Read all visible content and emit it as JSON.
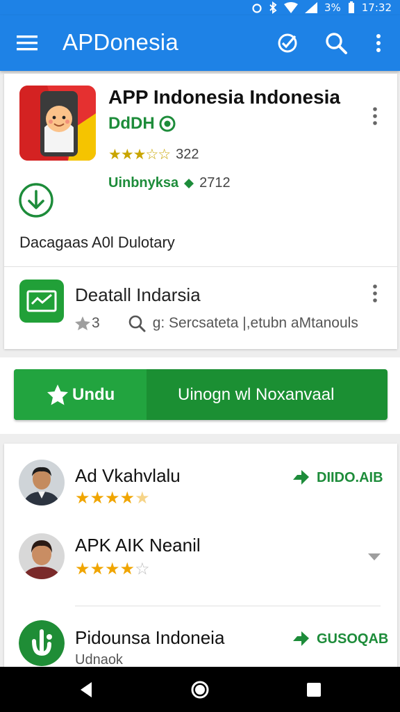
{
  "status": {
    "battery": "3%",
    "time": "17:32"
  },
  "appbar": {
    "title": "APDonesia"
  },
  "app": {
    "name": "APP Indonesia  Indonesia",
    "developer": "DdDH",
    "rating_stars": "★★★☆☆",
    "rating_count": "322",
    "downloads_label": "Uinbnyksa",
    "downloads_count": "2712",
    "description": "Dacagaas A0l Dulotary"
  },
  "detail": {
    "title": "Deatall Indarsia",
    "count": "3",
    "meta": "g: Sercsateta |,etubn aMtanouls"
  },
  "install": {
    "left_label": "Undu",
    "right_label": "Uinogn wl Noxanvaal"
  },
  "reviews": [
    {
      "name": "Ad Vkahvlalu",
      "stars_filled": "★★★★",
      "stars_empty": "★",
      "tag": "DIIDO.AIB"
    },
    {
      "name": "APK AIK Neanil",
      "stars_filled": "★★★★",
      "stars_empty": "☆",
      "tag": ""
    },
    {
      "name": "Pidounsa Indoneia",
      "sub": "Udnaok",
      "tag": "GUSOQAB"
    }
  ],
  "colors": {
    "primary": "#1e82e6",
    "green": "#1d8c3a",
    "install": "#22a43f",
    "star": "#f0a500"
  }
}
